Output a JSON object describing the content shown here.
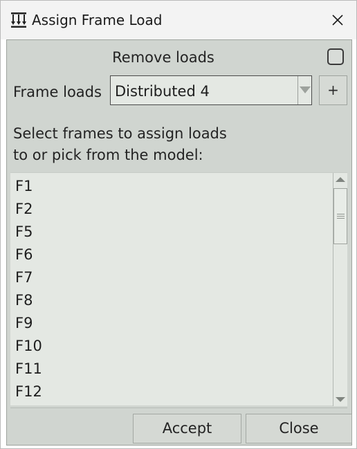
{
  "window": {
    "title": "Assign Frame Load",
    "icon": "frame-load-icon"
  },
  "remove_loads": {
    "label": "Remove loads",
    "checked": false
  },
  "frame_loads": {
    "label": "Frame loads",
    "selected": "Distributed 4",
    "add_label": "+"
  },
  "instructions": {
    "line1": "Select frames to assign loads",
    "line2": "to or pick from the model:"
  },
  "frames": [
    "F1",
    "F2",
    "F5",
    "F6",
    "F7",
    "F8",
    "F9",
    "F10",
    "F11",
    "F12"
  ],
  "buttons": {
    "accept": "Accept",
    "close": "Close"
  },
  "colors": {
    "panel": "#d0d5d0",
    "field": "#e4e8e3"
  }
}
